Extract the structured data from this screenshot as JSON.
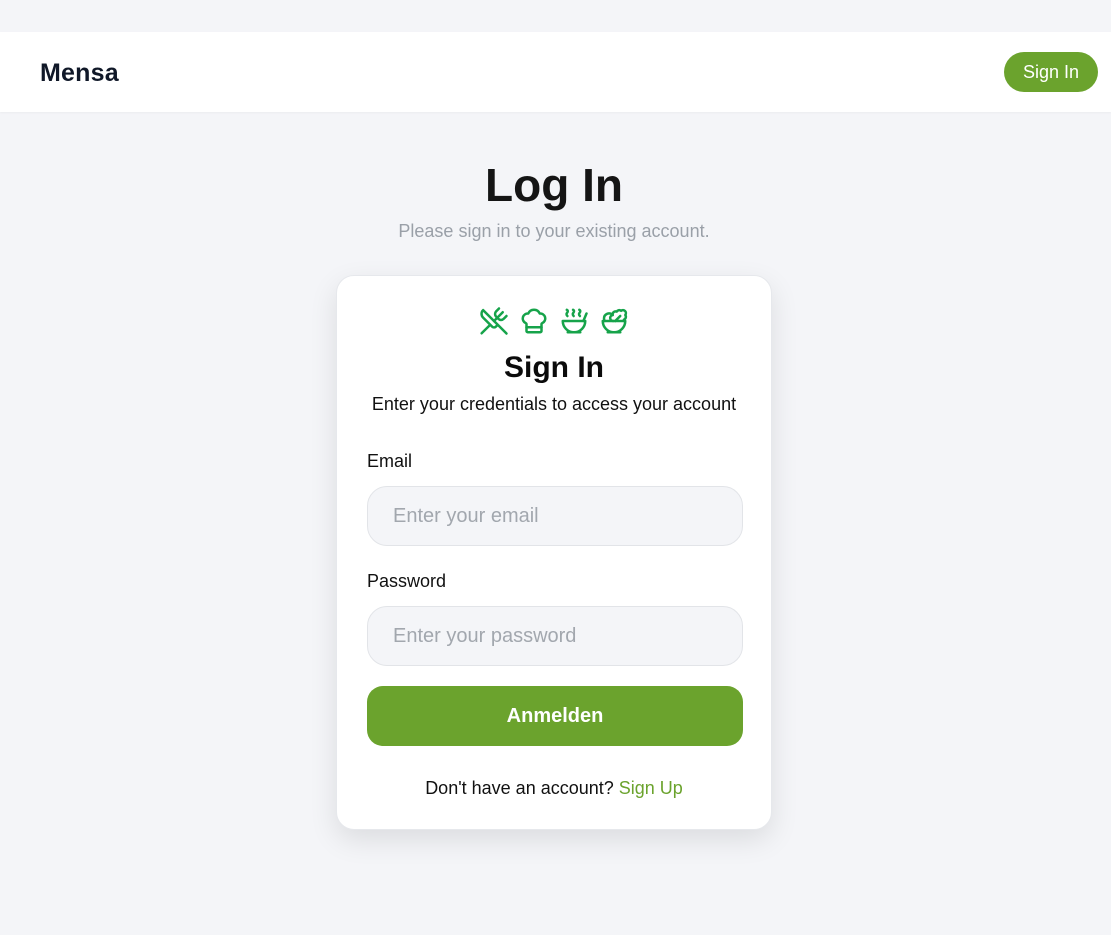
{
  "header": {
    "brand": "Mensa",
    "signin_label": "Sign In"
  },
  "page": {
    "title": "Log In",
    "subtitle": "Please sign in to your existing account."
  },
  "card": {
    "icons": [
      "utensils-crossed-icon",
      "chef-hat-icon",
      "soup-bowl-icon",
      "salad-bowl-icon"
    ],
    "title": "Sign In",
    "subtitle": "Enter your credentials to access your account",
    "email": {
      "label": "Email",
      "placeholder": "Enter your email",
      "value": ""
    },
    "password": {
      "label": "Password",
      "placeholder": "Enter your password",
      "value": ""
    },
    "submit_label": "Anmelden",
    "signup_prompt": "Don't have an account?",
    "signup_link": "Sign Up"
  },
  "colors": {
    "accent": "#6ba32d",
    "icon": "#16a34a",
    "background": "#f4f5f8"
  }
}
